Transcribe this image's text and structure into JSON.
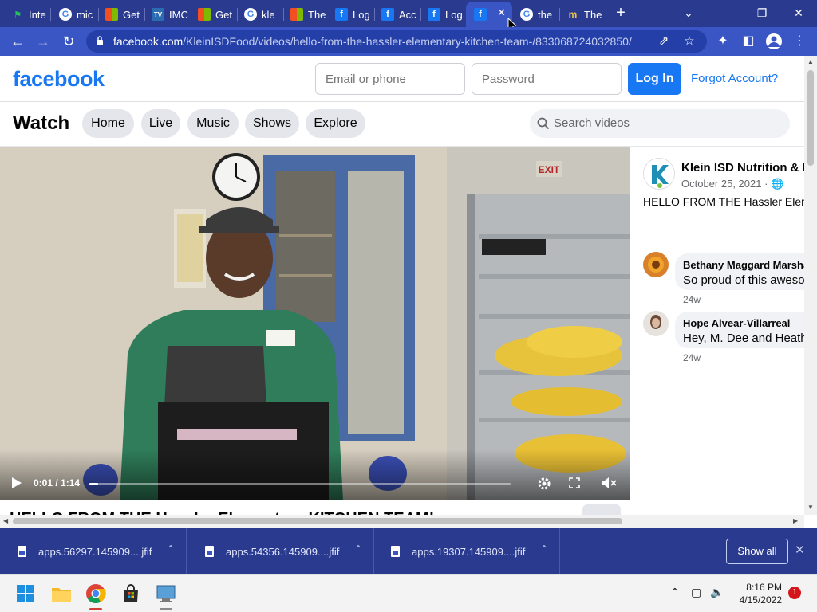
{
  "browser": {
    "tabs": [
      {
        "label": "Inte",
        "favicon": "flag-icon"
      },
      {
        "label": "mic",
        "favicon": "google-icon"
      },
      {
        "label": "Get",
        "favicon": "microsoft-store-icon"
      },
      {
        "label": "IMC",
        "favicon": "imdb-icon"
      },
      {
        "label": "Get",
        "favicon": "microsoft-store-icon"
      },
      {
        "label": "kle",
        "favicon": "google-icon"
      },
      {
        "label": "The",
        "favicon": "microsoft-store-icon"
      },
      {
        "label": "Log",
        "favicon": "facebook-icon"
      },
      {
        "label": "Acc",
        "favicon": "facebook-icon"
      },
      {
        "label": "Log",
        "favicon": "facebook-icon"
      },
      {
        "label": "",
        "favicon": "facebook-icon",
        "active": true
      },
      {
        "label": "the",
        "favicon": "google-icon"
      },
      {
        "label": "The",
        "favicon": "m-icon"
      }
    ],
    "url": "facebook.com",
    "url_path": "/KleinISDFood/videos/hello-from-the-hassler-elementary-kitchen-team-/833068724032850/"
  },
  "header": {
    "logo": "facebook",
    "email_placeholder": "Email or phone",
    "password_placeholder": "Password",
    "login_label": "Log In",
    "forgot_label": "Forgot Account?"
  },
  "watch": {
    "title": "Watch",
    "nav": [
      "Home",
      "Live",
      "Music",
      "Shows",
      "Explore"
    ],
    "search_placeholder": "Search videos"
  },
  "video": {
    "time": "0:01 / 1:14",
    "progress": 0.02,
    "title": "HELLO FROM THE Hassler Elementary KITCHEN TEAM!"
  },
  "post": {
    "page_name": "Klein ISD Nutrition & F",
    "date": "October 25, 2021 ·",
    "text_prefix": "HELLO FROM THE ",
    "text_bold": "Hassler Elem",
    "comments": [
      {
        "name": "Bethany Maggard Marsha",
        "text": "So proud of this aweso",
        "time": "24w"
      },
      {
        "name": "Hope Alvear-Villarreal",
        "text": "Hey, M. Dee and Heath",
        "time": "24w"
      }
    ]
  },
  "downloads": {
    "items": [
      "apps.56297.145909....jfif",
      "apps.54356.145909....jfif",
      "apps.19307.145909....jfif"
    ],
    "show_all": "Show all"
  },
  "taskbar": {
    "time": "8:16 PM",
    "date": "4/15/2022",
    "notifications": "1"
  },
  "colors": {
    "chrome_tabstrip": "#2a3b8f",
    "chrome_toolbar": "#3a55c4",
    "facebook_blue": "#1877f2"
  }
}
